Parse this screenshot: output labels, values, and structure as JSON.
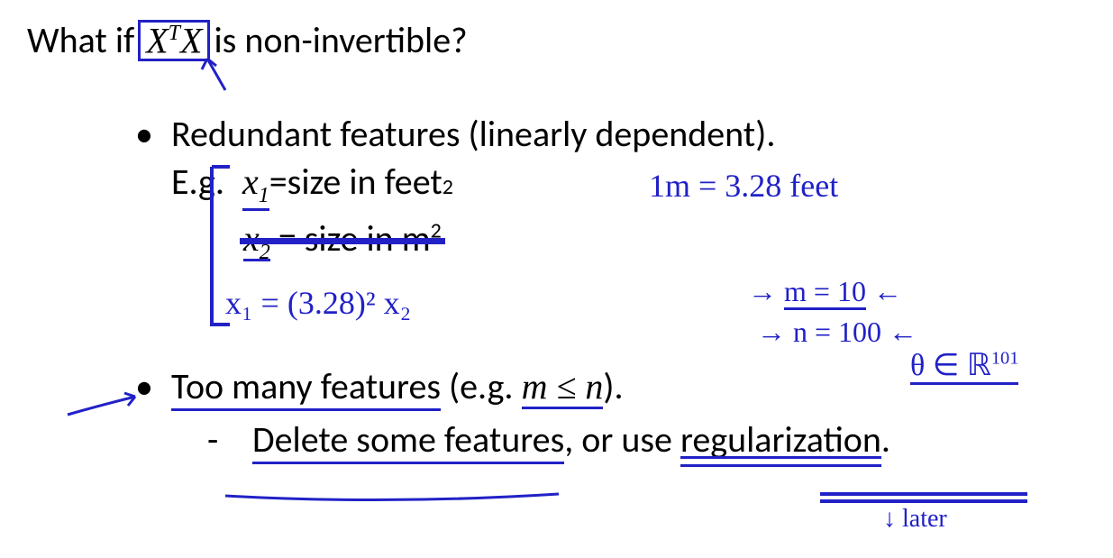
{
  "title": {
    "prefix": "What if",
    "math": "X",
    "math_sup": "T",
    "suffix": "is non-invertible?"
  },
  "bullet1": {
    "text": "Redundant features (linearly dependent).",
    "eg_label": "E.g.",
    "x1_var": "x",
    "x1_sub": "1",
    "x1_eq": " = ",
    "x1_desc": "size in feet",
    "x1_sup": "2",
    "x2_var": "x",
    "x2_sub": "2",
    "x2_eq": " = ",
    "x2_desc": "size in m",
    "x2_sup": "2"
  },
  "bullet2": {
    "text_a": "Too many features",
    "text_b": " (e.g. ",
    "math_m": "m",
    "math_rel": " ≤ ",
    "math_n": "n",
    "text_c": ").",
    "sub_text": "Delete some features, or use regularization."
  },
  "annotations": {
    "conversion": "1m = 3.28 feet",
    "relation": "x₁ = (3.28)² x₂",
    "m_eq": "m = 10",
    "n_eq": "n = 100",
    "theta": "θ ∈ ℝ",
    "theta_sup": "101",
    "later": "later",
    "arrow_up": "↖"
  }
}
